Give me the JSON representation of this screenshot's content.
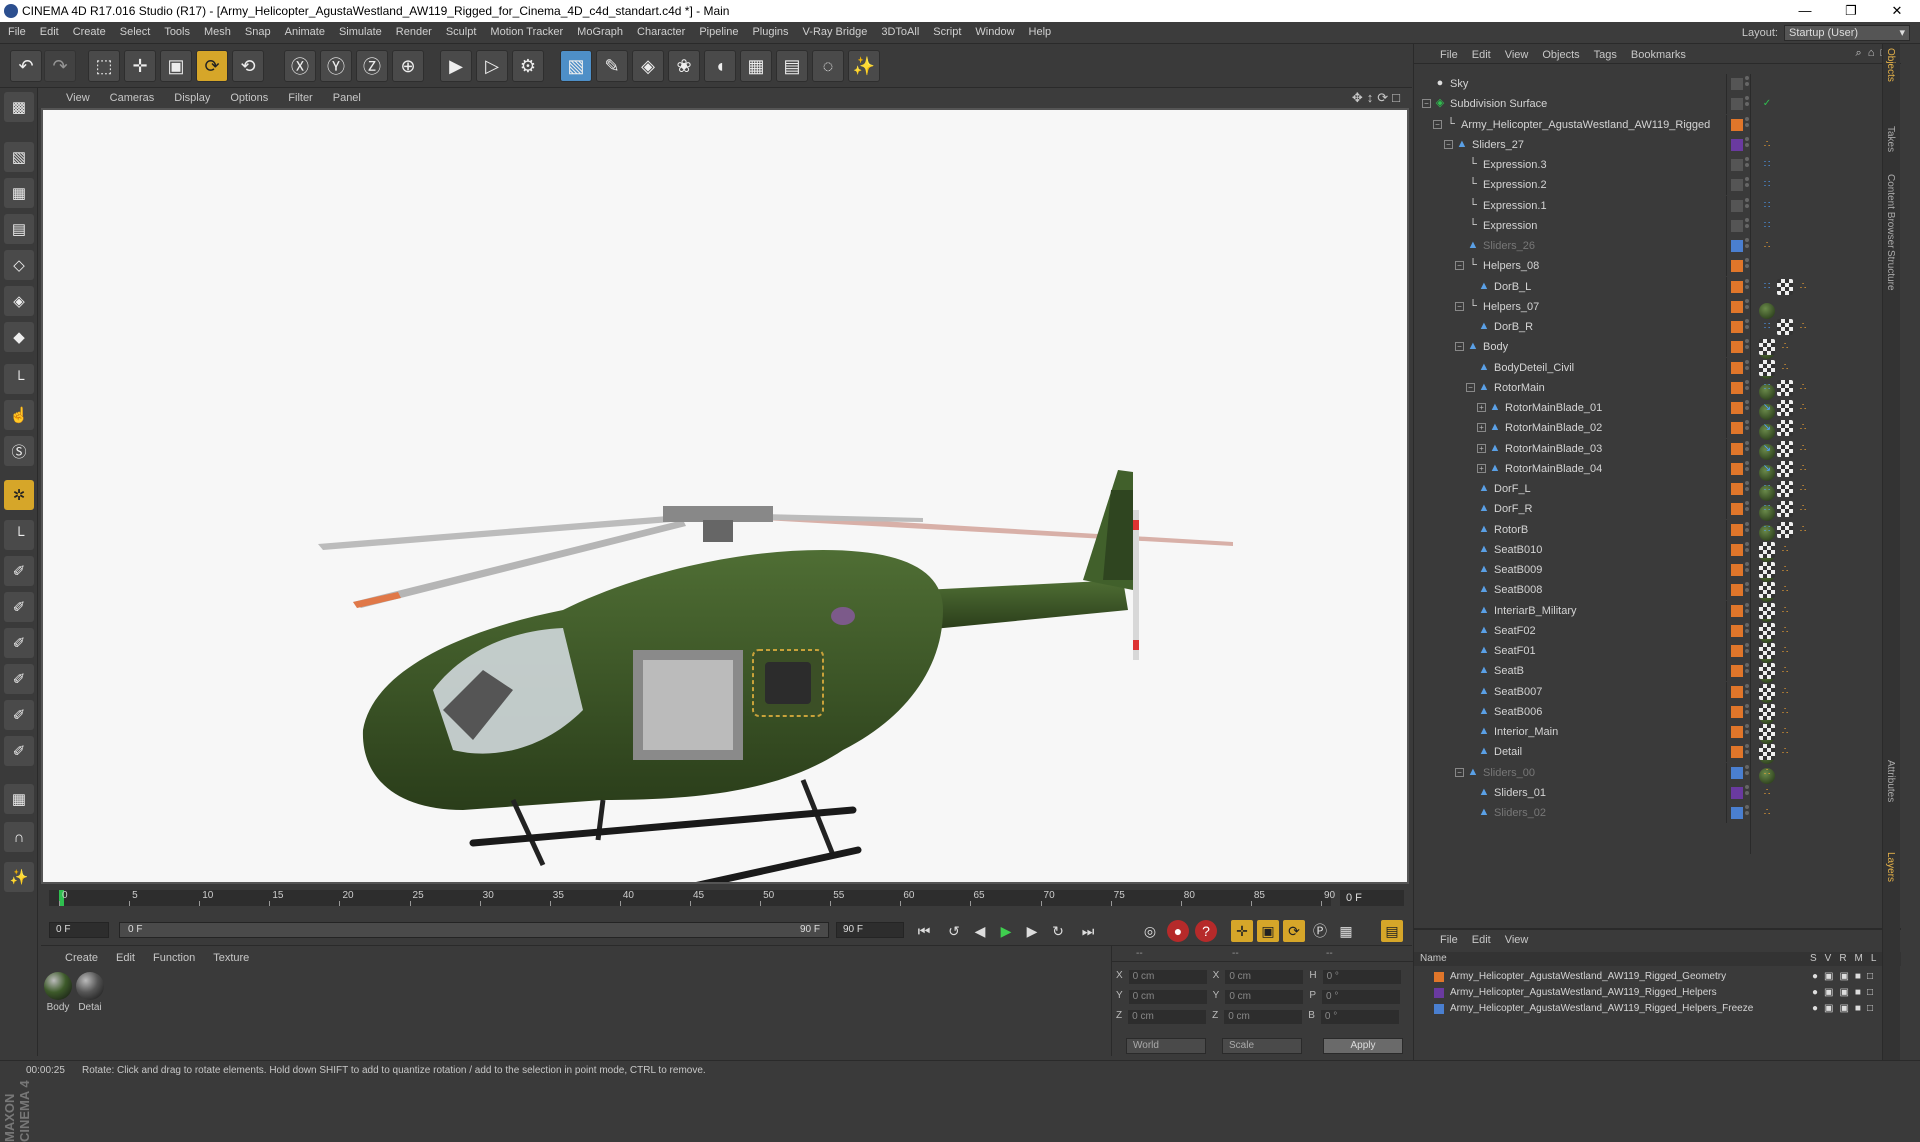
{
  "window": {
    "title": "CINEMA 4D R17.016 Studio (R17) - [Army_Helicopter_AgustaWestland_AW119_Rigged_for_Cinema_4D_c4d_standart.c4d *] - Main",
    "min": "—",
    "max": "❐",
    "close": "✕"
  },
  "menubar": {
    "items": [
      "File",
      "Edit",
      "Create",
      "Select",
      "Tools",
      "Mesh",
      "Snap",
      "Animate",
      "Simulate",
      "Render",
      "Sculpt",
      "Motion Tracker",
      "MoGraph",
      "Character",
      "Pipeline",
      "Plugins",
      "V-Ray Bridge",
      "3DToAll",
      "Script",
      "Window",
      "Help"
    ],
    "layout_label": "Layout:",
    "layout_value": "Startup (User)"
  },
  "viewport": {
    "menu": [
      "View",
      "Cameras",
      "Display",
      "Options",
      "Filter",
      "Panel"
    ],
    "nav_icons": "✥↕⟳□"
  },
  "timeline": {
    "ticks": [
      "0",
      "5",
      "10",
      "15",
      "20",
      "25",
      "30",
      "35",
      "40",
      "45",
      "50",
      "55",
      "60",
      "65",
      "70",
      "75",
      "80",
      "85",
      "90"
    ],
    "current_frame": "0 F"
  },
  "transport": {
    "start_field": "0 F",
    "range_start": "0 F",
    "range_end": "90 F",
    "end_field": "90 F"
  },
  "materials": {
    "menu": [
      "Create",
      "Edit",
      "Function",
      "Texture"
    ],
    "items": [
      {
        "name": "Body",
        "color": "#3d5a2a"
      },
      {
        "name": "Detai",
        "color": "#555555"
      }
    ]
  },
  "coords": {
    "header": [
      "--",
      "--",
      "--"
    ],
    "rows": [
      {
        "a": "X",
        "v1": "0 cm",
        "b": "X",
        "v2": "0 cm",
        "c": "H",
        "v3": "0 °"
      },
      {
        "a": "Y",
        "v1": "0 cm",
        "b": "Y",
        "v2": "0 cm",
        "c": "P",
        "v3": "0 °"
      },
      {
        "a": "Z",
        "v1": "0 cm",
        "b": "Z",
        "v2": "0 cm",
        "c": "B",
        "v3": "0 °"
      }
    ],
    "mode1": "World",
    "mode2": "Scale",
    "apply": "Apply"
  },
  "status": {
    "time": "00:00:25",
    "message": "Rotate: Click and drag to rotate elements. Hold down SHIFT to add to quantize rotation / add to the selection in point mode, CTRL to remove."
  },
  "objects": {
    "menu": [
      "File",
      "Edit",
      "View",
      "Objects",
      "Tags",
      "Bookmarks"
    ],
    "rows": [
      {
        "name": "Sky",
        "indent": 0,
        "icon": "sky",
        "dim": false,
        "layer": "#555555",
        "tags": []
      },
      {
        "name": "Subdivision Surface",
        "indent": 0,
        "icon": "subd",
        "dim": false,
        "layer": "#555555",
        "tags": [
          "check"
        ]
      },
      {
        "name": "Army_Helicopter_AgustaWestland_AW119_Rigged",
        "indent": 1,
        "icon": "null",
        "dim": false,
        "layer": "#e0762a",
        "tags": []
      },
      {
        "name": "Sliders_27",
        "indent": 2,
        "icon": "poly",
        "dim": false,
        "layer": "#6a3aa0",
        "tags": [
          "dots"
        ]
      },
      {
        "name": "Expression.3",
        "indent": 3,
        "icon": "null",
        "dim": false,
        "layer": "#555555",
        "tags": [
          "xpr"
        ]
      },
      {
        "name": "Expression.2",
        "indent": 3,
        "icon": "null",
        "dim": false,
        "layer": "#555555",
        "tags": [
          "xpr"
        ]
      },
      {
        "name": "Expression.1",
        "indent": 3,
        "icon": "null",
        "dim": false,
        "layer": "#555555",
        "tags": [
          "xpr"
        ]
      },
      {
        "name": "Expression",
        "indent": 3,
        "icon": "null",
        "dim": false,
        "layer": "#555555",
        "tags": [
          "xpr"
        ]
      },
      {
        "name": "Sliders_26",
        "indent": 3,
        "icon": "poly",
        "dim": true,
        "layer": "#4a7fd0",
        "tags": [
          "dots"
        ]
      },
      {
        "name": "Helpers_08",
        "indent": 3,
        "icon": "null",
        "dim": false,
        "layer": "#e0762a",
        "tags": []
      },
      {
        "name": "DorB_L",
        "indent": 4,
        "icon": "poly",
        "dim": false,
        "layer": "#e0762a",
        "tags": [
          "xpr",
          "mat",
          "chk",
          "dots"
        ]
      },
      {
        "name": "Helpers_07",
        "indent": 3,
        "icon": "null",
        "dim": false,
        "layer": "#e0762a",
        "tags": []
      },
      {
        "name": "DorB_R",
        "indent": 4,
        "icon": "poly",
        "dim": false,
        "layer": "#e0762a",
        "tags": [
          "xpr",
          "mat",
          "chk",
          "dots"
        ]
      },
      {
        "name": "Body",
        "indent": 3,
        "icon": "poly",
        "dim": false,
        "layer": "#e0762a",
        "tags": [
          "mat",
          "chk",
          "dots"
        ]
      },
      {
        "name": "BodyDeteil_Civil",
        "indent": 4,
        "icon": "poly",
        "dim": false,
        "layer": "#e0762a",
        "tags": [
          "mat",
          "chk",
          "dots"
        ]
      },
      {
        "name": "RotorMain",
        "indent": 4,
        "icon": "poly",
        "dim": false,
        "layer": "#e0762a",
        "tags": [
          "xpr",
          "mat",
          "chk",
          "dots"
        ]
      },
      {
        "name": "RotorMainBlade_01",
        "indent": 5,
        "icon": "poly",
        "dim": false,
        "layer": "#e0762a",
        "tags": [
          "ik",
          "mat",
          "chk",
          "dots"
        ]
      },
      {
        "name": "RotorMainBlade_02",
        "indent": 5,
        "icon": "poly",
        "dim": false,
        "layer": "#e0762a",
        "tags": [
          "ik",
          "mat",
          "chk",
          "dots"
        ]
      },
      {
        "name": "RotorMainBlade_03",
        "indent": 5,
        "icon": "poly",
        "dim": false,
        "layer": "#e0762a",
        "tags": [
          "ik",
          "mat",
          "chk",
          "dots"
        ]
      },
      {
        "name": "RotorMainBlade_04",
        "indent": 5,
        "icon": "poly",
        "dim": false,
        "layer": "#e0762a",
        "tags": [
          "ik",
          "mat",
          "chk",
          "dots"
        ]
      },
      {
        "name": "DorF_L",
        "indent": 4,
        "icon": "poly",
        "dim": false,
        "layer": "#e0762a",
        "tags": [
          "xpr",
          "mat",
          "chk",
          "dots"
        ]
      },
      {
        "name": "DorF_R",
        "indent": 4,
        "icon": "poly",
        "dim": false,
        "layer": "#e0762a",
        "tags": [
          "xpr",
          "mat",
          "chk",
          "dots"
        ]
      },
      {
        "name": "RotorB",
        "indent": 4,
        "icon": "poly",
        "dim": false,
        "layer": "#e0762a",
        "tags": [
          "xpr",
          "mat",
          "chk",
          "dots"
        ]
      },
      {
        "name": "SeatB010",
        "indent": 4,
        "icon": "poly",
        "dim": false,
        "layer": "#e0762a",
        "tags": [
          "mat",
          "chk",
          "dots"
        ]
      },
      {
        "name": "SeatB009",
        "indent": 4,
        "icon": "poly",
        "dim": false,
        "layer": "#e0762a",
        "tags": [
          "mat",
          "chk",
          "dots"
        ]
      },
      {
        "name": "SeatB008",
        "indent": 4,
        "icon": "poly",
        "dim": false,
        "layer": "#e0762a",
        "tags": [
          "mat",
          "chk",
          "dots"
        ]
      },
      {
        "name": "InteriarB_Military",
        "indent": 4,
        "icon": "poly",
        "dim": false,
        "layer": "#e0762a",
        "tags": [
          "mat",
          "chk",
          "dots"
        ]
      },
      {
        "name": "SeatF02",
        "indent": 4,
        "icon": "poly",
        "dim": false,
        "layer": "#e0762a",
        "tags": [
          "mat",
          "chk",
          "dots"
        ]
      },
      {
        "name": "SeatF01",
        "indent": 4,
        "icon": "poly",
        "dim": false,
        "layer": "#e0762a",
        "tags": [
          "mat",
          "chk",
          "dots"
        ]
      },
      {
        "name": "SeatB",
        "indent": 4,
        "icon": "poly",
        "dim": false,
        "layer": "#e0762a",
        "tags": [
          "mat",
          "chk",
          "dots"
        ]
      },
      {
        "name": "SeatB007",
        "indent": 4,
        "icon": "poly",
        "dim": false,
        "layer": "#e0762a",
        "tags": [
          "mat",
          "chk",
          "dots"
        ]
      },
      {
        "name": "SeatB006",
        "indent": 4,
        "icon": "poly",
        "dim": false,
        "layer": "#e0762a",
        "tags": [
          "mat",
          "chk",
          "dots"
        ]
      },
      {
        "name": "Interior_Main",
        "indent": 4,
        "icon": "poly",
        "dim": false,
        "layer": "#e0762a",
        "tags": [
          "mat",
          "chk",
          "dots"
        ]
      },
      {
        "name": "Detail",
        "indent": 4,
        "icon": "poly",
        "dim": false,
        "layer": "#e0762a",
        "tags": [
          "mat",
          "chk",
          "dots"
        ]
      },
      {
        "name": "Sliders_00",
        "indent": 3,
        "icon": "poly",
        "dim": true,
        "layer": "#4a7fd0",
        "tags": [
          "dots"
        ]
      },
      {
        "name": "Sliders_01",
        "indent": 4,
        "icon": "poly",
        "dim": false,
        "layer": "#6a3aa0",
        "tags": [
          "dots"
        ]
      },
      {
        "name": "Sliders_02",
        "indent": 4,
        "icon": "poly",
        "dim": true,
        "layer": "#4a7fd0",
        "tags": [
          "dots"
        ]
      }
    ]
  },
  "layers": {
    "menu": [
      "File",
      "Edit",
      "View"
    ],
    "header_name": "Name",
    "header_cols": [
      "S",
      "V",
      "R",
      "M",
      "L"
    ],
    "rows": [
      {
        "name": "Army_Helicopter_AgustaWestland_AW119_Rigged_Geometry",
        "color": "#e0762a"
      },
      {
        "name": "Army_Helicopter_AgustaWestland_AW119_Rigged_Helpers",
        "color": "#6a3aa0"
      },
      {
        "name": "Army_Helicopter_AgustaWestland_AW119_Rigged_Helpers_Freeze",
        "color": "#4a7fd0"
      }
    ]
  },
  "sidetabs": [
    "Objects",
    "Takes",
    "Content Browser",
    "Structure",
    "Attributes",
    "Layers"
  ],
  "brand": "MAXON CINEMA 4D"
}
